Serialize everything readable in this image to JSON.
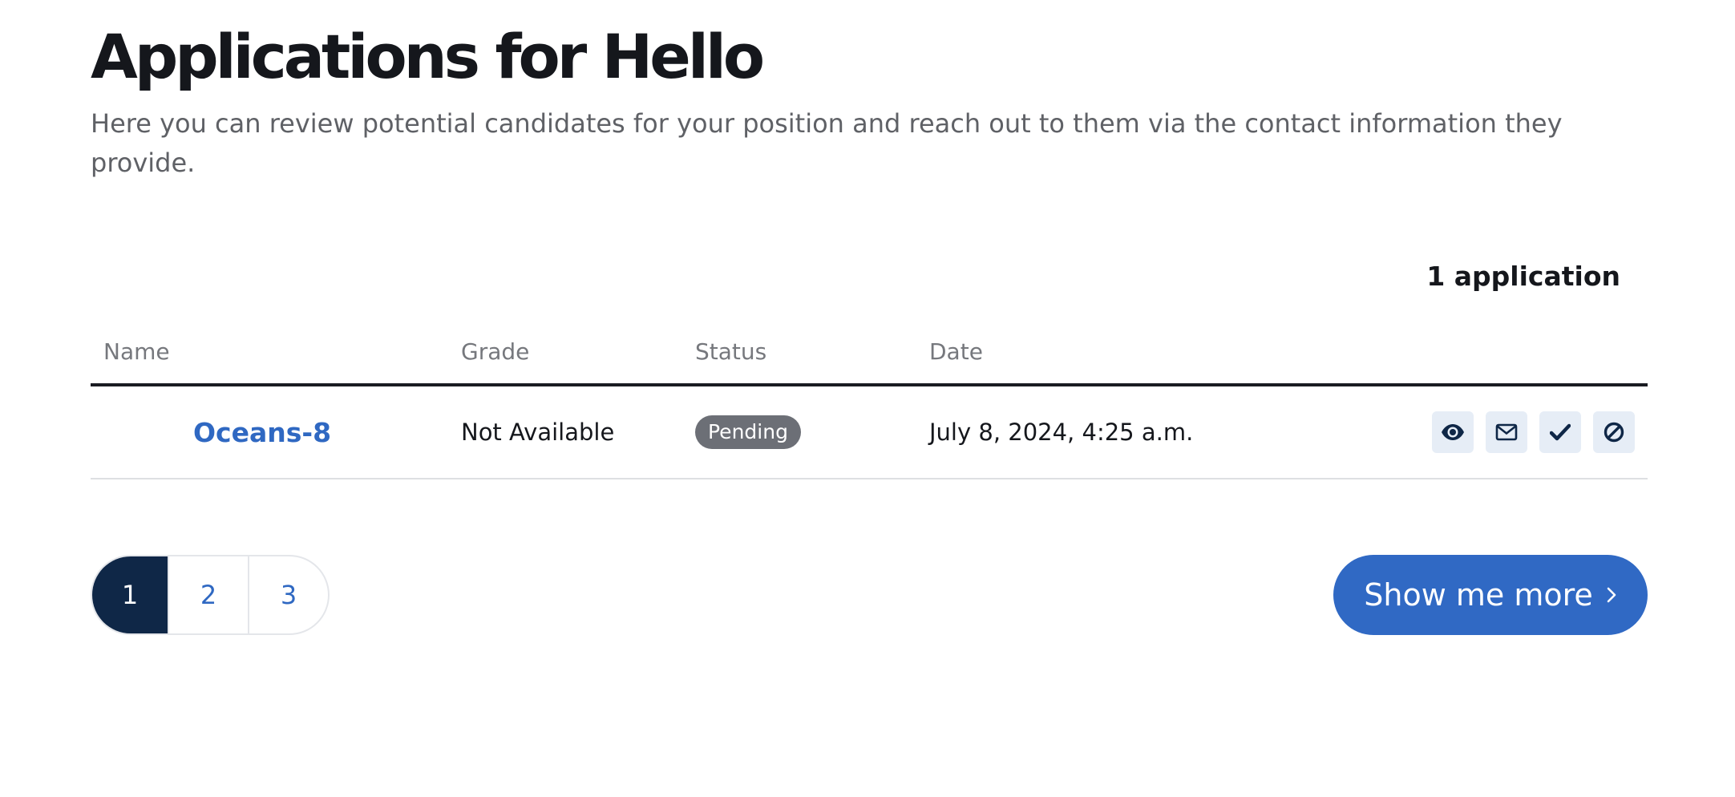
{
  "header": {
    "title": "Applications for Hello",
    "subtitle": "Here you can review potential candidates for your position and reach out to them via the contact information they provide."
  },
  "summary": {
    "count_label": "1 application"
  },
  "table": {
    "columns": [
      "Name",
      "Grade",
      "Status",
      "Date"
    ],
    "rows": [
      {
        "name": "Oceans-8",
        "grade": "Not Available",
        "status": "Pending",
        "date": "July 8, 2024, 4:25 a.m.",
        "actions": [
          "eye-icon",
          "envelope-icon",
          "check-icon",
          "ban-icon"
        ]
      }
    ]
  },
  "pagination": {
    "pages": [
      "1",
      "2",
      "3"
    ],
    "current": "1"
  },
  "more_button": {
    "label": "Show me more",
    "icon": "chevron-right-icon"
  },
  "colors": {
    "accent": "#2f68c2",
    "active_page": "#0f2747",
    "badge_pending": "#6c6f76",
    "action_bg": "#e6edf6"
  }
}
